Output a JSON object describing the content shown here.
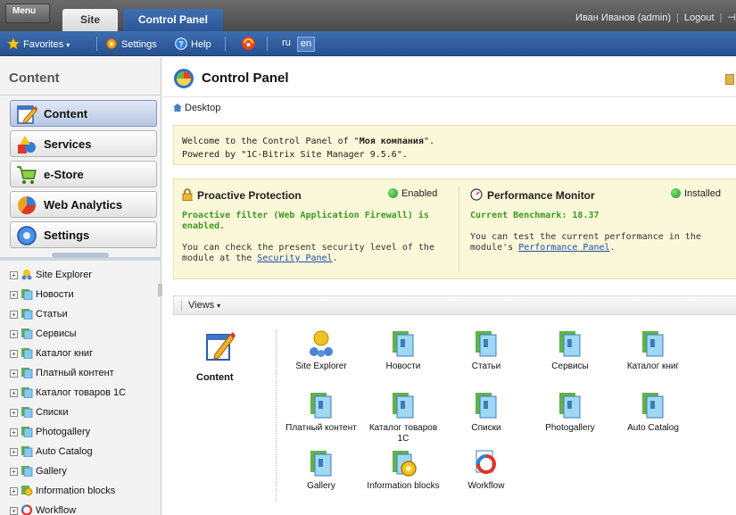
{
  "topbar": {
    "menu_label": "Menu",
    "tabs": [
      {
        "label": "Site"
      },
      {
        "label": "Control Panel"
      }
    ],
    "user": "Иван Иванов (admin)",
    "logout": "Logout"
  },
  "toolbar": {
    "favorites": "Favorites",
    "settings": "Settings",
    "help": "Help",
    "lang_ru": "ru",
    "lang_en": "en"
  },
  "sidebar": {
    "title": "Content",
    "sections": [
      {
        "label": "Content"
      },
      {
        "label": "Services"
      },
      {
        "label": "e-Store"
      },
      {
        "label": "Web Analytics"
      },
      {
        "label": "Settings"
      }
    ],
    "tree": [
      {
        "label": "Site Explorer",
        "icon": "site-explorer-icon"
      },
      {
        "label": "Новости",
        "icon": "iblock-icon"
      },
      {
        "label": "Статьи",
        "icon": "iblock-icon"
      },
      {
        "label": "Сервисы",
        "icon": "iblock-icon"
      },
      {
        "label": "Каталог книг",
        "icon": "iblock-icon"
      },
      {
        "label": "Платный контент",
        "icon": "iblock-icon"
      },
      {
        "label": "Каталог товаров 1С",
        "icon": "iblock-icon"
      },
      {
        "label": "Списки",
        "icon": "iblock-icon"
      },
      {
        "label": "Photogallery",
        "icon": "iblock-icon"
      },
      {
        "label": "Auto Catalog",
        "icon": "iblock-icon"
      },
      {
        "label": "Gallery",
        "icon": "iblock-icon"
      },
      {
        "label": "Information blocks",
        "icon": "information-blocks-icon"
      },
      {
        "label": "Workflow",
        "icon": "workflow-icon"
      }
    ]
  },
  "main": {
    "title": "Control Panel",
    "breadcrumb": "Desktop",
    "welcome_line1_pre": "Welcome to the Control Panel of \"",
    "welcome_company": "Моя компания",
    "welcome_line1_post": "\".",
    "welcome_line2": "Powered by \"1C-Bitrix Site Manager 9.5.6\".",
    "proactive": {
      "title": "Proactive Protection",
      "state": "Enabled",
      "headline": "Proactive filter (Web Application Firewall) is enabled.",
      "text": "You can check the present security level of the module at the ",
      "link": "Security Panel",
      "text_end": "."
    },
    "performance": {
      "title": "Performance Monitor",
      "state": "Installed",
      "headline": "Current Benchmark: 18.37",
      "text": "You can test the current performance in the module's ",
      "link": "Performance Panel",
      "text_end": "."
    },
    "views_label": "Views",
    "content_label": "Content",
    "grid": [
      {
        "label": "Site Explorer",
        "icon": "site-explorer-icon"
      },
      {
        "label": "Новости",
        "icon": "iblock-icon"
      },
      {
        "label": "Статьи",
        "icon": "iblock-icon"
      },
      {
        "label": "Сервисы",
        "icon": "iblock-icon"
      },
      {
        "label": "Каталог книг",
        "icon": "iblock-icon"
      },
      {
        "label": "Платный контент",
        "icon": "iblock-icon"
      },
      {
        "label": "Каталог товаров 1С",
        "icon": "iblock-icon"
      },
      {
        "label": "Списки",
        "icon": "iblock-icon"
      },
      {
        "label": "Photogallery",
        "icon": "iblock-icon"
      },
      {
        "label": "Auto Catalog",
        "icon": "iblock-icon"
      },
      {
        "label": "Gallery",
        "icon": "iblock-icon"
      },
      {
        "label": "Information blocks",
        "icon": "information-blocks-icon"
      },
      {
        "label": "Workflow",
        "icon": "workflow-icon"
      }
    ]
  }
}
